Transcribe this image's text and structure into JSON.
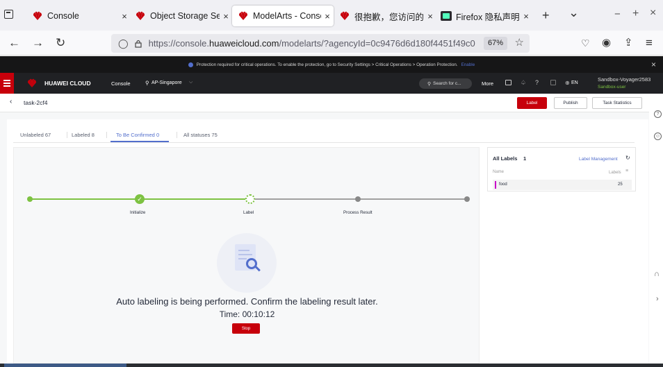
{
  "browser": {
    "tabs": [
      {
        "title": "Console",
        "close": "×",
        "active": false
      },
      {
        "title": "Object Storage Ser",
        "close": "×",
        "active": false
      },
      {
        "title": "ModelArts - Conso",
        "close": "×",
        "active": true
      },
      {
        "title": "很抱歉，您访问的",
        "close": "×",
        "active": false
      },
      {
        "title": "Firefox 隐私声明 ",
        "close": "×",
        "active": false
      }
    ],
    "new_tab": "+",
    "list_tabs": "⌄",
    "window_controls": {
      "minimize": "−",
      "maximize": "+",
      "close": "×"
    },
    "url": {
      "prefix": "https://console.",
      "domain": "huaweicloud.com",
      "suffix": "/modelarts/?agencyId=0c9476d6d180f4451f49c0"
    },
    "zoom": "67%"
  },
  "security_banner": {
    "text": "Protection required for critical operations. To enable the protection, go to Security Settings > Critical Operations > Operation Protection.",
    "link": "Enable",
    "close": "×"
  },
  "header": {
    "brand": "HUAWEI CLOUD",
    "console": "Console",
    "region": "AP-Singapore",
    "search_placeholder": "Search for c...",
    "more": "More",
    "lang": "EN",
    "user": "Sandbox-Voyager2583",
    "user_sub": "Sandbox-user"
  },
  "topbar": {
    "task": "task-2cf4",
    "buttons": {
      "label": "Label",
      "publish": "Publish",
      "stats": "Task Statistics"
    }
  },
  "status_tabs": [
    {
      "label": "Unlabeled 67"
    },
    {
      "label": "Labeled 8"
    },
    {
      "label": "To Be Confirmed 0",
      "active": true
    },
    {
      "label": "All statuses 75"
    }
  ],
  "progress": {
    "steps": [
      {
        "label": "Initialize",
        "state": "done"
      },
      {
        "label": "Label",
        "state": "loading"
      },
      {
        "label": "Process Result",
        "state": "pending"
      }
    ]
  },
  "message": {
    "text": "Auto labeling is being performed. Confirm the labeling result later.",
    "time_label": "Time: 00:10:12",
    "stop": "Stop"
  },
  "labels_panel": {
    "title": "All Labels",
    "count": "1",
    "manage": "Label Management",
    "col_name": "Name",
    "col_labels": "Labels",
    "rows": [
      {
        "name": "food",
        "count": "25",
        "color": "#c800c8"
      }
    ]
  },
  "colors": {
    "brand_red": "#c7000b",
    "green": "#7dc242",
    "accent_blue": "#526ecc"
  }
}
